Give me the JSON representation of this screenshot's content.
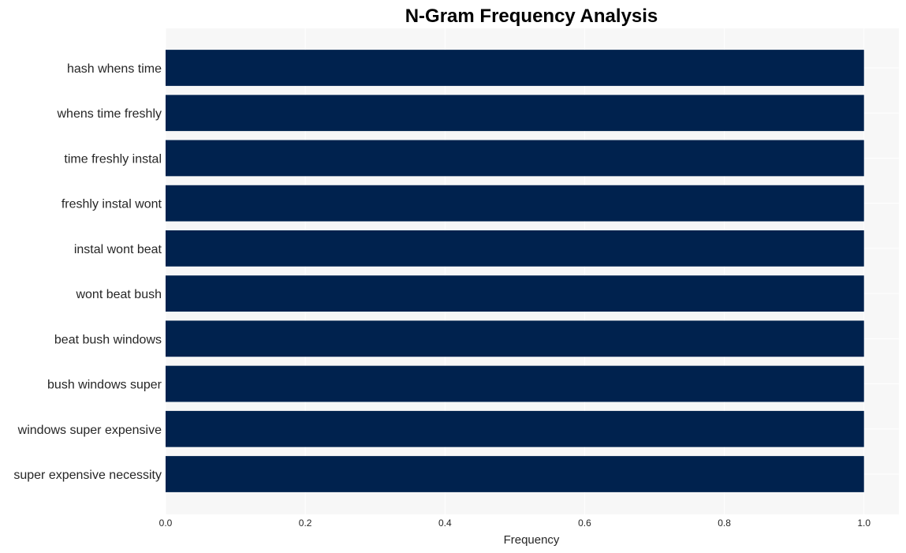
{
  "chart_data": {
    "type": "bar",
    "orientation": "horizontal",
    "title": "N-Gram Frequency Analysis",
    "xlabel": "Frequency",
    "ylabel": "",
    "categories": [
      "hash whens time",
      "whens time freshly",
      "time freshly instal",
      "freshly instal wont",
      "instal wont beat",
      "wont beat bush",
      "beat bush windows",
      "bush windows super",
      "windows super expensive",
      "super expensive necessity"
    ],
    "values": [
      1,
      1,
      1,
      1,
      1,
      1,
      1,
      1,
      1,
      1
    ],
    "xlim": [
      0,
      1.05
    ],
    "xticks": [
      0.0,
      0.2,
      0.4,
      0.6,
      0.8,
      1.0
    ],
    "xtick_labels": [
      "0.0",
      "0.2",
      "0.4",
      "0.6",
      "0.8",
      "1.0"
    ],
    "grid": true,
    "legend": "none",
    "colors": {
      "bar": "#00224e",
      "plot_background": "#f7f7f7",
      "grid": "#ffffff",
      "text": "#262626"
    }
  }
}
